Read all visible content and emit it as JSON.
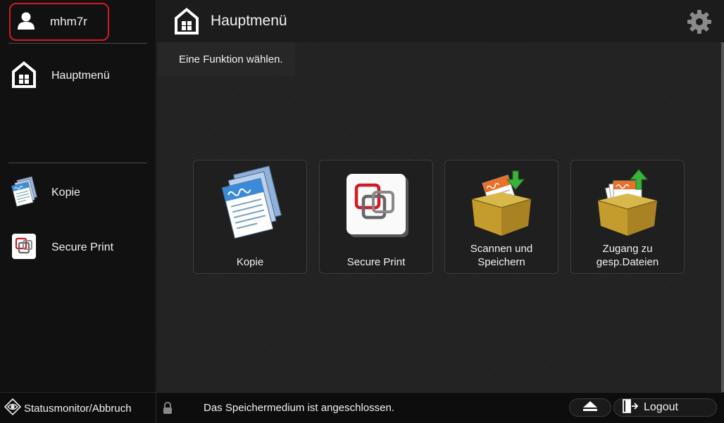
{
  "sidebar": {
    "user": {
      "name": "mhm7r",
      "icon": "user-icon"
    },
    "home": {
      "label": "Hauptmenü",
      "icon": "home-icon"
    },
    "items": [
      {
        "label": "Kopie",
        "icon": "copy-icon"
      },
      {
        "label": "Secure Print",
        "icon": "secure-print-icon"
      }
    ]
  },
  "header": {
    "title": "Hauptmenü",
    "icon": "home-icon",
    "settings_icon": "gear-icon"
  },
  "main": {
    "instruction": "Eine Funktion wählen.",
    "tiles": [
      {
        "label": "Kopie",
        "icon": "copy-icon"
      },
      {
        "label": "Secure Print",
        "icon": "secure-print-icon"
      },
      {
        "label": "Scannen und\nSpeichern",
        "icon": "scan-and-store-icon"
      },
      {
        "label": "Zugang zu\ngesp.Dateien",
        "icon": "access-stored-files-icon"
      }
    ]
  },
  "statusbar": {
    "status_monitor_label": "Statusmonitor/Abbruch",
    "message": "Das Speichermedium ist angeschlossen.",
    "logout_label": "Logout"
  },
  "colors": {
    "highlight_border": "#d01c24",
    "background": "#141414",
    "secure_print_red": "#d01c24"
  }
}
